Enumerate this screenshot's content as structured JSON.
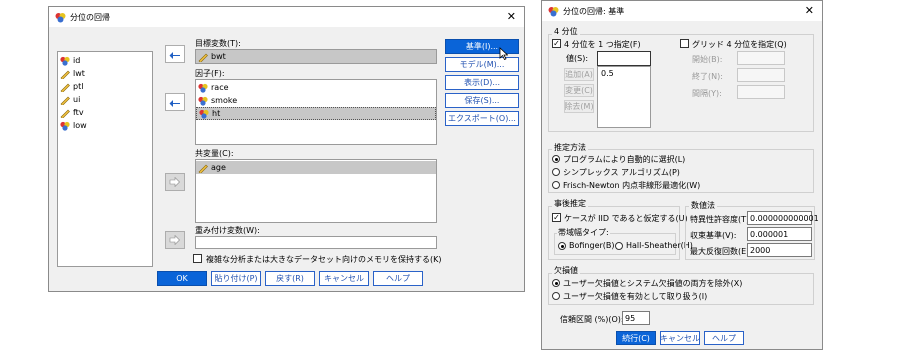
{
  "left_dialog": {
    "title": "分位の回帰",
    "variables": [
      {
        "name": "id",
        "icon": "nominal"
      },
      {
        "name": "lwt",
        "icon": "scale"
      },
      {
        "name": "ptl",
        "icon": "scale"
      },
      {
        "name": "ui",
        "icon": "scale"
      },
      {
        "name": "ftv",
        "icon": "scale"
      },
      {
        "name": "low",
        "icon": "nominal"
      }
    ],
    "target_label": "目標変数(T):",
    "target_var": "bwt",
    "factor_label": "因子(F):",
    "factors": [
      "race",
      "smoke",
      "ht"
    ],
    "covariate_label": "共変量(C):",
    "covariates": [
      "age"
    ],
    "weight_label": "重み付け変数(W):",
    "memory_checkbox_label": "複雑な分析または大きなデータセット向けのメモリを保持する(K)",
    "side_buttons": [
      "基準(I)...",
      "モデル(M)...",
      "表示(D)...",
      "保存(S)...",
      "エクスポート(O)..."
    ],
    "bottom_buttons": [
      "OK",
      "貼り付け(P)",
      "戻す(R)",
      "キャンセル",
      "ヘルプ"
    ]
  },
  "right_dialog": {
    "title": "分位の回帰: 基準",
    "quantile_group": "4 分位",
    "single_quantile_label": "4 分位を 1 つ指定(F)",
    "value_label": "値(S):",
    "value_input": "",
    "value_list": [
      "0.5"
    ],
    "value_buttons": [
      "追加(A)",
      "変更(C)",
      "除去(M)"
    ],
    "grid_label": "グリッド 4 分位を指定(Q)",
    "grid_fields": [
      "開始(B):",
      "終了(N):",
      "間隔(Y):"
    ],
    "estimation_group": "推定方法",
    "estimation_options": [
      "プログラムにより自動的に選択(L)",
      "シンプレックス アルゴリズム(P)",
      "Frisch-Newton 内点非線形最適化(W)"
    ],
    "inference_group": "事後推定",
    "iid_label": "ケースが IID であると仮定する(U)",
    "bandwidth_label": "帯域幅タイプ:",
    "bandwidth_options": [
      "Bofinger(B)",
      "Hall-Sheather(H)"
    ],
    "numeric_group": "数値法",
    "numeric_fields": [
      {
        "label": "特異性許容度(T):",
        "value": "0.000000000001"
      },
      {
        "label": "収束基準(V):",
        "value": "0.000001"
      },
      {
        "label": "最大反復回数(E):",
        "value": "2000"
      }
    ],
    "missing_group": "欠損値",
    "missing_options": [
      "ユーザー欠損値とシステム欠損値の両方を除外(X)",
      "ユーザー欠損値を有効として取り扱う(I)"
    ],
    "ci_label": "信頼区間 (%)(O):",
    "ci_value": "95",
    "bottom_buttons": [
      "続行(C)",
      "キャンセル",
      "ヘルプ"
    ]
  }
}
